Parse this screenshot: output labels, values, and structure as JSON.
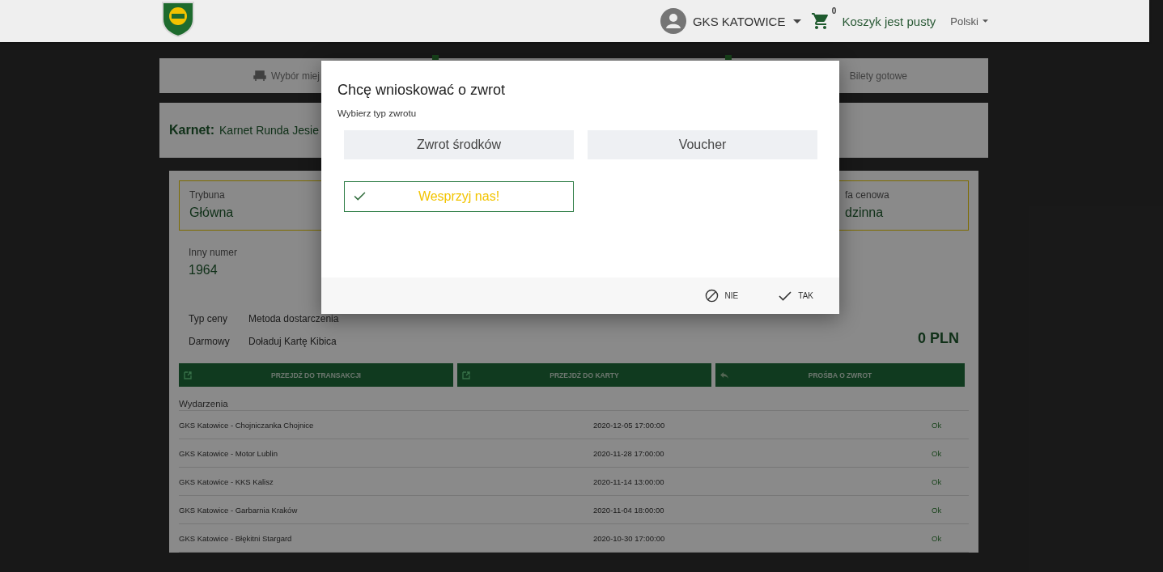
{
  "header": {
    "account": "GKS KATOWICE",
    "cart_count": "0",
    "cart_label": "Koszyk jest pusty",
    "language": "Polski"
  },
  "steps": [
    "Wybór miej",
    "Bilety gotowe"
  ],
  "pass": {
    "label": "Karnet:",
    "name": "Karnet Runda Jesie"
  },
  "details": {
    "fields": [
      {
        "label": "Trybuna",
        "value": "Główna"
      },
      {
        "label": "fa cenowa",
        "value": "dzinna"
      }
    ],
    "other_number": {
      "label": "Inny numer",
      "value": "1964"
    },
    "columns": [
      "Typ ceny",
      "Metoda dostarczenia"
    ],
    "values": [
      "Darmowy",
      "Doładuj Kartę Kibica"
    ],
    "price": "0 PLN"
  },
  "actions": [
    {
      "label": "PRZEJDŹ DO TRANSAKCJI",
      "kind": "external"
    },
    {
      "label": "PRZEJDŹ DO KARTY",
      "kind": "external"
    },
    {
      "label": "PROŚBA O ZWROT",
      "kind": "reply"
    }
  ],
  "events": {
    "title": "Wydarzenia",
    "rows": [
      {
        "name": "GKS Katowice - Chojniczanka Chojnice",
        "date": "2020-12-05 17:00:00",
        "status": "Ok"
      },
      {
        "name": "GKS Katowice - Motor Lublin",
        "date": "2020-11-28 17:00:00",
        "status": "Ok"
      },
      {
        "name": "GKS Katowice - KKS Kalisz",
        "date": "2020-11-14 13:00:00",
        "status": "Ok"
      },
      {
        "name": "GKS Katowice - Garbarnia Kraków",
        "date": "2020-11-04 18:00:00",
        "status": "Ok"
      },
      {
        "name": "GKS Katowice - Błękitni Stargard",
        "date": "2020-10-30 17:00:00",
        "status": "Ok"
      }
    ]
  },
  "modal": {
    "title": "Chcę wnioskować o zwrot",
    "subtitle": "Wybierz typ zwrotu",
    "options": [
      {
        "label": "Zwrot środków",
        "selected": false
      },
      {
        "label": "Voucher",
        "selected": false
      },
      {
        "label": "Wesprzyj nas!",
        "selected": true
      }
    ],
    "buttons": [
      {
        "label": "NIE",
        "kind": "cancel"
      },
      {
        "label": "TAK",
        "kind": "confirm"
      }
    ]
  }
}
